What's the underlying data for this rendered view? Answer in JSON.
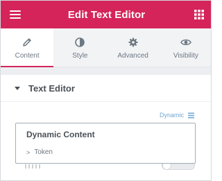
{
  "header": {
    "title": "Edit Text Editor",
    "menu_icon": "hamburger-icon",
    "apps_icon": "grid-icon",
    "color": "#d5245a"
  },
  "tabs": [
    {
      "label": "Content",
      "icon": "pencil-icon",
      "active": true
    },
    {
      "label": "Style",
      "icon": "half-circle-icon",
      "active": false
    },
    {
      "label": "Advanced",
      "icon": "gear-icon",
      "active": false
    },
    {
      "label": "Visibility",
      "icon": "eye-icon",
      "active": false
    }
  ],
  "section": {
    "title": "Text Editor",
    "caret_icon": "caret-down-icon"
  },
  "dynamic": {
    "label": "Dynamic",
    "icon": "stack-icon",
    "color": "#71a6d2"
  },
  "dropdown": {
    "title": "Dynamic Content",
    "items": [
      {
        "label": "Token",
        "icon": "chevron-right-icon"
      }
    ]
  }
}
